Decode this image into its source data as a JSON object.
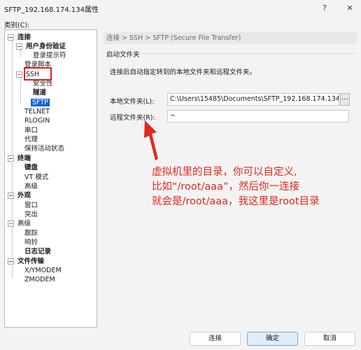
{
  "window": {
    "title": "SFTP_192.168.174.134属性",
    "help_label": "?",
    "close_label": "✕"
  },
  "category_label": "类别(C):",
  "tree": {
    "items": [
      {
        "label": "连接",
        "expander": "−"
      },
      {
        "label": "用户身份验证",
        "expander": "−"
      },
      {
        "label": "登录提示符"
      },
      {
        "label": "登录脚本"
      },
      {
        "label": "SSH",
        "expander": "−"
      },
      {
        "label": "安全性"
      },
      {
        "label": "隧道"
      },
      {
        "label": "SFTP",
        "selected": true
      },
      {
        "label": "TELNET"
      },
      {
        "label": "RLOGIN"
      },
      {
        "label": "串口"
      },
      {
        "label": "代理"
      },
      {
        "label": "保持活动状态"
      },
      {
        "label": "终端",
        "expander": "−"
      },
      {
        "label": "键盘"
      },
      {
        "label": "VT 模式"
      },
      {
        "label": "高级"
      },
      {
        "label": "外观",
        "expander": "−"
      },
      {
        "label": "窗口"
      },
      {
        "label": "突出"
      },
      {
        "label": "高级",
        "expander": "−"
      },
      {
        "label": "跟踪"
      },
      {
        "label": "响铃"
      },
      {
        "label": "日志记录"
      },
      {
        "label": "文件传输",
        "expander": "−"
      },
      {
        "label": "X/YMODEM"
      },
      {
        "label": "ZMODEM"
      }
    ]
  },
  "panel": {
    "breadcrumb": "连接 > SSH > SFTP (Secure File Transfer)",
    "group_title": "启动文件夹",
    "description": "连接后自动指定转到的本地文件夹和远程文件夹。",
    "local_label": "本地文件夹(L):",
    "local_value": "C:\\Users\\15485\\Documents\\SFTP_192.168.174.134",
    "browse_label": "...",
    "remote_label": "远程文件夹(R):",
    "remote_value": "~"
  },
  "annotation": {
    "line1": "虚拟机里的目录，你可以自定义,",
    "line2": "比如“/root/aaa”，然后你一连接",
    "line3": "就会是/root/aaa，我这里是root目录",
    "color": "#e0281f"
  },
  "buttons": {
    "connect": "连接",
    "ok": "确定",
    "cancel": "取消"
  }
}
